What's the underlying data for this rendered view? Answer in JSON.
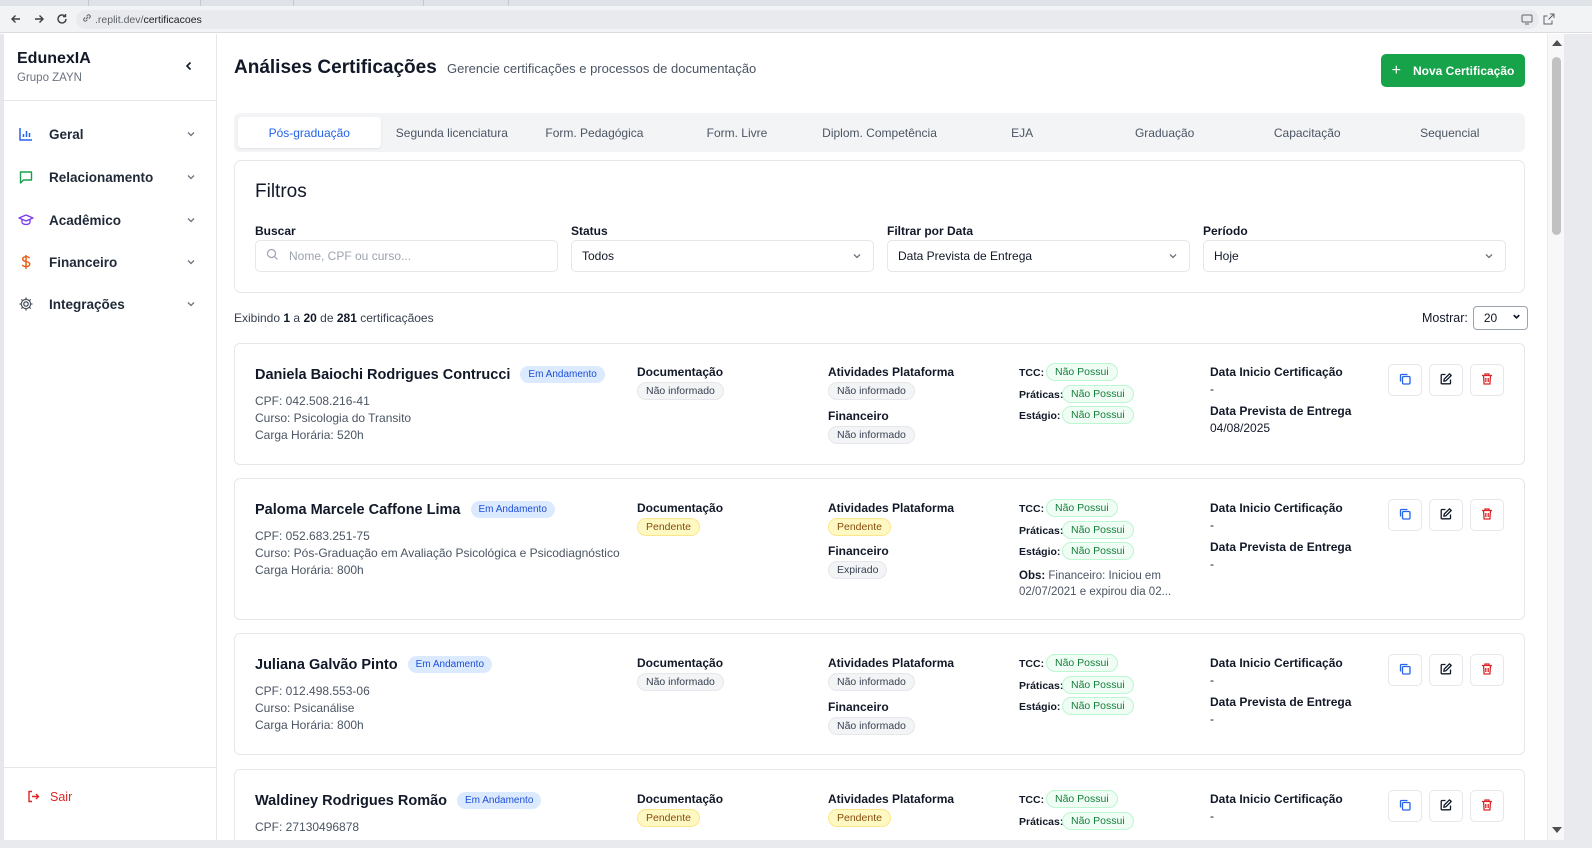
{
  "browser": {
    "url_host": ".replit.dev/",
    "url_path": "certificacoes"
  },
  "sidebar": {
    "brand": "EdunexIA",
    "brand_sub": "Grupo ZAYN",
    "items": [
      {
        "label": "Geral",
        "icon": "bar-chart-icon",
        "color": "#2563eb"
      },
      {
        "label": "Relacionamento",
        "icon": "message-square-icon",
        "color": "#16a34a"
      },
      {
        "label": "Acadêmico",
        "icon": "graduation-cap-icon",
        "color": "#7c3aed"
      },
      {
        "label": "Financeiro",
        "icon": "dollar-sign-icon",
        "color": "#ea580c"
      },
      {
        "label": "Integrações",
        "icon": "gear-icon",
        "color": "#4b5563"
      }
    ],
    "logout": "Sair"
  },
  "header": {
    "title": "Análises Certificações",
    "subtitle": "Gerencie certificações e processos de documentação",
    "new_button": "Nova Certificação"
  },
  "tabs": [
    {
      "label": "Pós-graduação",
      "active": true
    },
    {
      "label": "Segunda licenciatura",
      "active": false
    },
    {
      "label": "Form. Pedagógica",
      "active": false
    },
    {
      "label": "Form. Livre",
      "active": false
    },
    {
      "label": "Diplom. Competência",
      "active": false
    },
    {
      "label": "EJA",
      "active": false
    },
    {
      "label": "Graduação",
      "active": false
    },
    {
      "label": "Capacitação",
      "active": false
    },
    {
      "label": "Sequencial",
      "active": false
    }
  ],
  "filters": {
    "title": "Filtros",
    "search_label": "Buscar",
    "search_placeholder": "Nome, CPF ou curso...",
    "status_label": "Status",
    "status_value": "Todos",
    "date_label": "Filtrar por Data",
    "date_value": "Data Prevista de Entrega",
    "period_label": "Período",
    "period_value": "Hoje"
  },
  "summary": {
    "prefix": "Exibindo",
    "from": "1",
    "a": "a",
    "to": "20",
    "de": "de",
    "total": "281",
    "suffix": "certificaçãoes",
    "show_label": "Mostrar:",
    "show_value": "20"
  },
  "labels": {
    "documentacao": "Documentação",
    "atividades": "Atividades Plataforma",
    "financeiro": "Financeiro",
    "tcc": "TCC:",
    "praticas": "Práticas:",
    "estagio": "Estágio:",
    "data_inicio": "Data Inicio Certificação",
    "data_prevista": "Data Prevista de Entrega",
    "obs": "Obs:"
  },
  "cards": [
    {
      "name": "Daniela Baiochi Rodrigues Contrucci",
      "status": "Em Andamento",
      "cpf": "CPF: 042.508.216-41",
      "curso": "Curso: Psicologia do Transito",
      "carga": "Carga Horária: 520h",
      "documentacao": "Não informado",
      "atividades": "Não informado",
      "financeiro": "Não informado",
      "tcc": "Não Possui",
      "praticas": "Não Possui",
      "estagio": "Não Possui",
      "data_inicio": "-",
      "data_prevista": "04/08/2025",
      "obs": ""
    },
    {
      "name": "Paloma Marcele Caffone Lima",
      "status": "Em Andamento",
      "cpf": "CPF: 052.683.251-75",
      "curso": "Curso: Pós-Graduação em Avaliação Psicológica e Psicodiagnóstico",
      "carga": "Carga Horária: 800h",
      "documentacao": "Pendente",
      "atividades": "Pendente",
      "financeiro": "Expirado",
      "tcc": "Não Possui",
      "praticas": "Não Possui",
      "estagio": "Não Possui",
      "data_inicio": "-",
      "data_prevista": "-",
      "obs": "Financeiro: Iniciou em 02/07/2021 e expirou dia 02..."
    },
    {
      "name": "Juliana Galvão Pinto",
      "status": "Em Andamento",
      "cpf": "CPF: 012.498.553-06",
      "curso": "Curso: Psicanálise",
      "carga": "Carga Horária: 800h",
      "documentacao": "Não informado",
      "atividades": "Não informado",
      "financeiro": "Não informado",
      "tcc": "Não Possui",
      "praticas": "Não Possui",
      "estagio": "Não Possui",
      "data_inicio": "-",
      "data_prevista": "-",
      "obs": ""
    },
    {
      "name": "Waldiney Rodrigues Romão",
      "status": "Em Andamento",
      "cpf": "CPF: 27130496878",
      "documentacao": "Pendente",
      "atividades": "Pendente",
      "tcc": "Não Possui",
      "praticas": "Não Possui",
      "data_inicio": "-"
    }
  ],
  "colors": {
    "primary_green": "#16a34a",
    "active_tab_blue": "#2563eb",
    "danger_red": "#dc2626"
  }
}
